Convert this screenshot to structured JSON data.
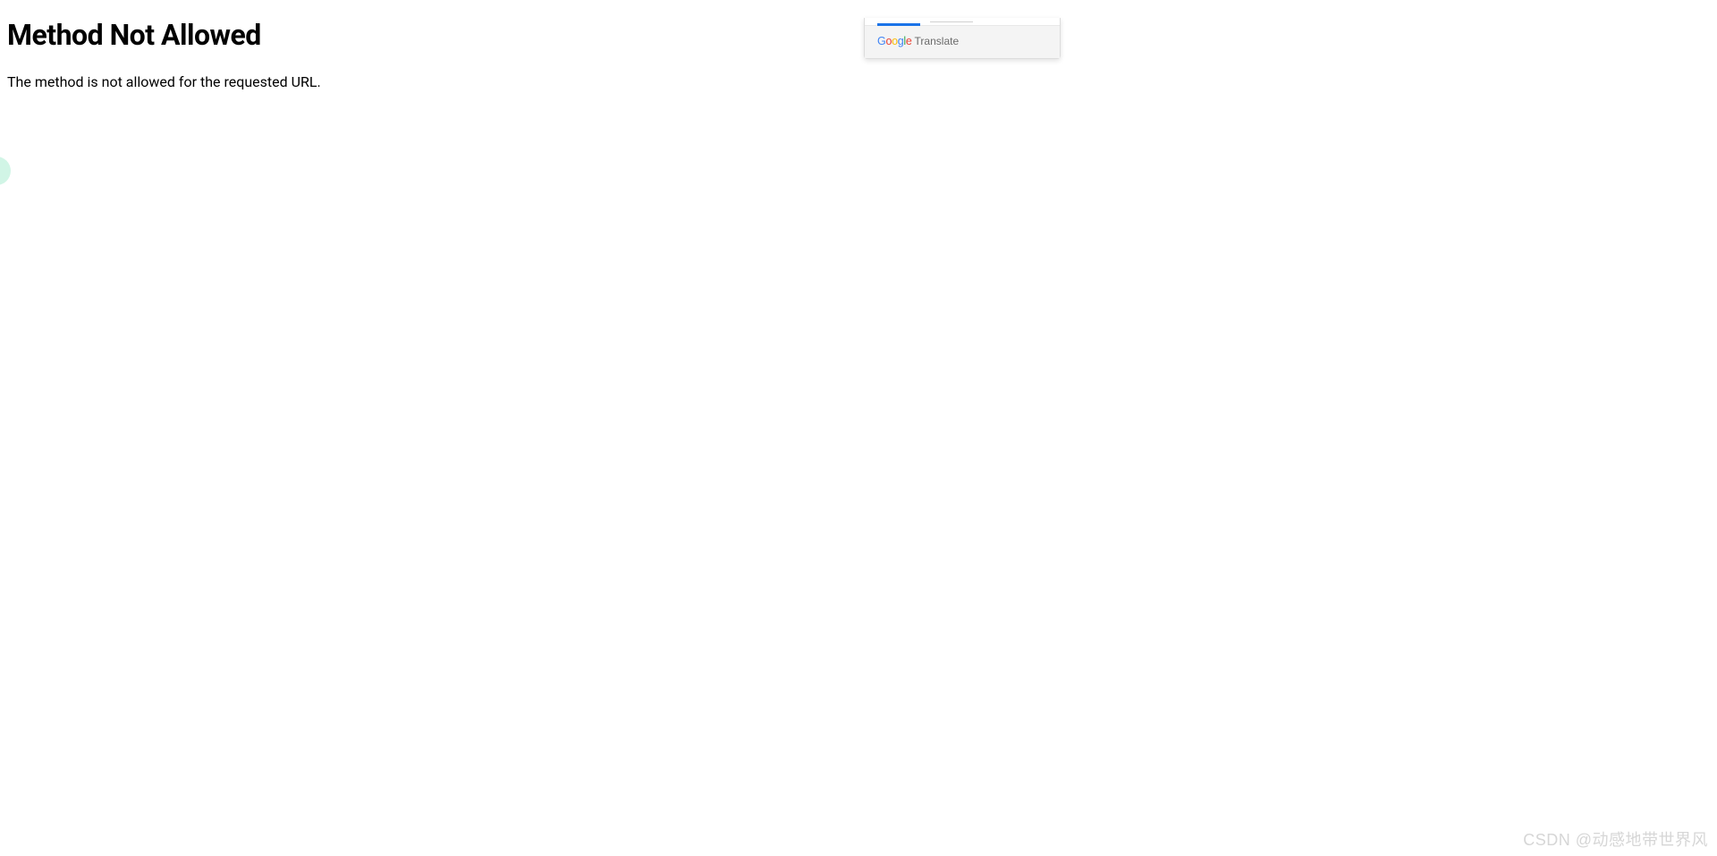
{
  "error": {
    "heading": "Method Not Allowed",
    "message": "The method is not allowed for the requested URL."
  },
  "translate_popup": {
    "google_letters": [
      "G",
      "o",
      "o",
      "g",
      "l",
      "e"
    ],
    "translate_label": "Translate"
  },
  "watermark": {
    "text": "CSDN @动感地带世界风"
  }
}
